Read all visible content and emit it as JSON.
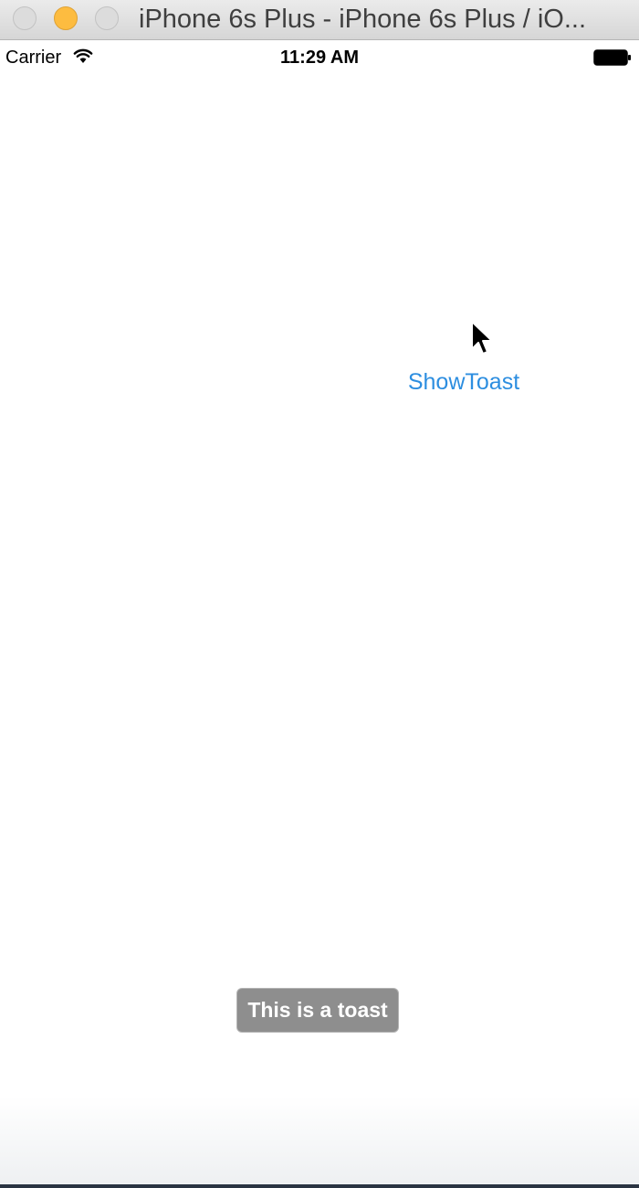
{
  "window": {
    "title": "iPhone 6s Plus - iPhone 6s Plus / iO..."
  },
  "statusbar": {
    "carrier": "Carrier",
    "time": "11:29 AM",
    "wifi_icon": "wifi-icon",
    "battery_icon": "battery-icon"
  },
  "main": {
    "show_toast_label": "ShowToast",
    "toast_message": "This is a toast"
  },
  "colors": {
    "link_blue": "#2d8ee0",
    "toast_bg": "#8e8e8e",
    "minimize_yellow": "#fdbc40"
  }
}
